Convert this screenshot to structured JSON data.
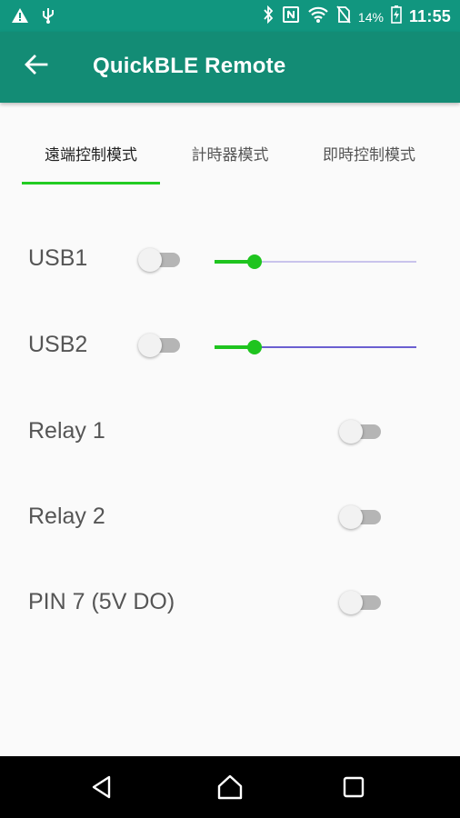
{
  "status_bar": {
    "battery_percent": "14%",
    "time": "11:55",
    "icons": [
      "warning-icon",
      "usb-icon",
      "bluetooth-icon",
      "nfc-icon",
      "wifi-icon",
      "no-sim-icon",
      "battery-icon"
    ]
  },
  "app_bar": {
    "title": "QuickBLE Remote",
    "back_icon": "arrow-back-icon"
  },
  "tabs": [
    {
      "label": "遠端控制模式",
      "active": true
    },
    {
      "label": "計時器模式",
      "active": false
    },
    {
      "label": "即時控制模式",
      "active": false
    }
  ],
  "controls": {
    "usb1": {
      "label": "USB1",
      "switch_on": false,
      "slider_value_percent": 20
    },
    "usb2": {
      "label": "USB2",
      "switch_on": false,
      "slider_value_percent": 20
    },
    "relay1": {
      "label": "Relay 1",
      "switch_on": false
    },
    "relay2": {
      "label": "Relay 2",
      "switch_on": false
    },
    "pin7": {
      "label": "PIN 7 (5V DO)",
      "switch_on": false
    }
  },
  "colors": {
    "status_bar": "#11967f",
    "app_bar": "#138c75",
    "accent": "#1fc41f",
    "slider_rail_usb1": "#c9c3ec",
    "slider_rail_usb2": "#6a5fd0"
  },
  "nav_bar": {
    "icons": [
      "nav-back-icon",
      "nav-home-icon",
      "nav-recents-icon"
    ]
  }
}
